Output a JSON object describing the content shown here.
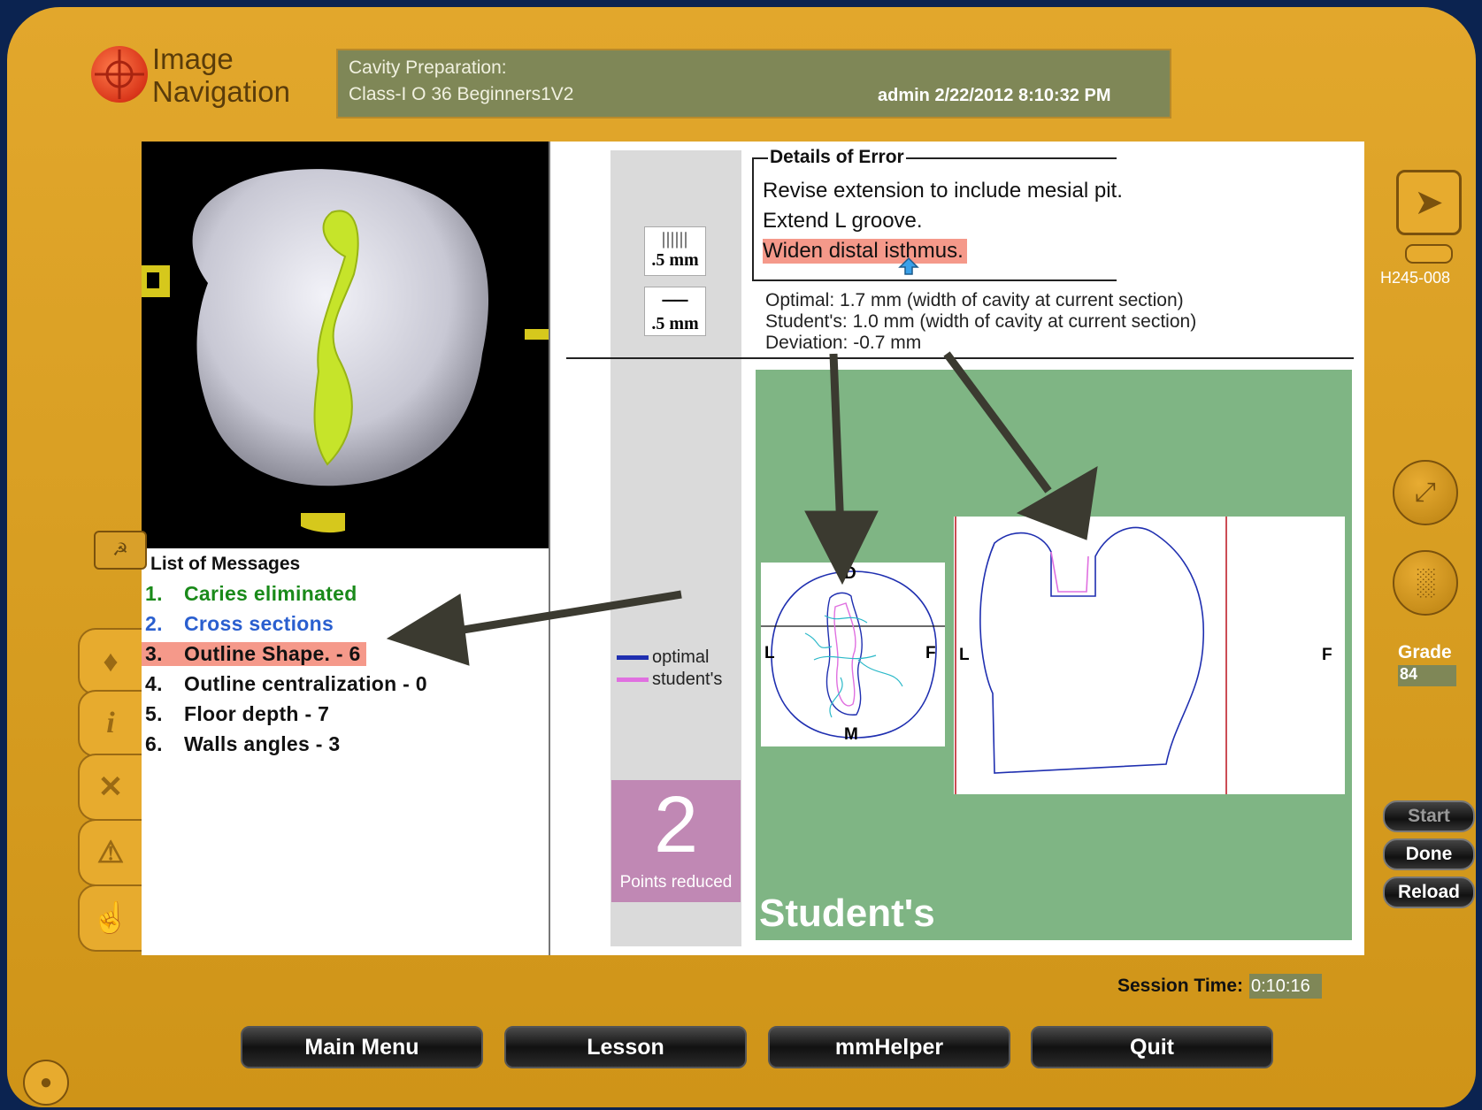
{
  "app": {
    "logo_line1": "Image",
    "logo_line2": "Navigation"
  },
  "header": {
    "line1": "Cavity Preparation:",
    "line2": "Class-I O 36 Beginners1V2",
    "user_info": "admin 2/22/2012 8:10:32 PM"
  },
  "messages": {
    "title": "List of Messages",
    "items": [
      {
        "num": "1.",
        "text": "Caries eliminated",
        "color": "#1a8a1a"
      },
      {
        "num": "2.",
        "text": "Cross sections",
        "color": "#2a5fcf"
      },
      {
        "num": "3.",
        "text": "Outline Shape. - 6",
        "color": "#111111",
        "highlight": "#f5998a"
      },
      {
        "num": "4.",
        "text": "Outline centralization  - 0",
        "color": "#111111"
      },
      {
        "num": "5.",
        "text": "Floor depth  - 7",
        "color": "#111111"
      },
      {
        "num": "6.",
        "text": "Walls angles - 3",
        "color": "#111111"
      }
    ]
  },
  "details": {
    "title": "Details of Error",
    "lines": [
      "Revise extension to include mesial pit.",
      "Extend L groove.",
      "Widen distal isthmus."
    ],
    "optimal": "Optimal:    1.7 mm (width of cavity at current section)",
    "student": "Student's: 1.0 mm (width of cavity at current section)",
    "deviation": "Deviation: -0.7 mm"
  },
  "scale": {
    "label1": ".5 mm",
    "label2": ".5 mm"
  },
  "legend": {
    "optimal": "optimal",
    "student": "student's",
    "optimal_color": "#1f2fb0",
    "student_color": "#e070e0"
  },
  "points": {
    "value": "2",
    "label": "Points reduced"
  },
  "views": {
    "student_label": "Student's",
    "occlusal": {
      "top": "D",
      "bottom": "M",
      "left": "L",
      "right": "F"
    },
    "section": {
      "left": "L",
      "right": "F"
    }
  },
  "right_panel": {
    "code": "H245-008",
    "grade_label": "Grade",
    "grade_value": "84"
  },
  "actions": {
    "start": "Start",
    "done": "Done",
    "reload": "Reload"
  },
  "session": {
    "label": "Session Time:",
    "value": "0:10:16"
  },
  "nav": {
    "main_menu": "Main Menu",
    "lesson": "Lesson",
    "mmhelper": "mmHelper",
    "quit": "Quit"
  },
  "side_tabs": [
    "tooth-icon",
    "info-icon",
    "close-icon",
    "warning-icon",
    "hand-icon"
  ],
  "colors": {
    "frame": "#daa024",
    "header_bg": "#7f8757",
    "green_panel": "#7fb584",
    "highlight": "#f5998a",
    "points_bg": "#c088b4"
  }
}
